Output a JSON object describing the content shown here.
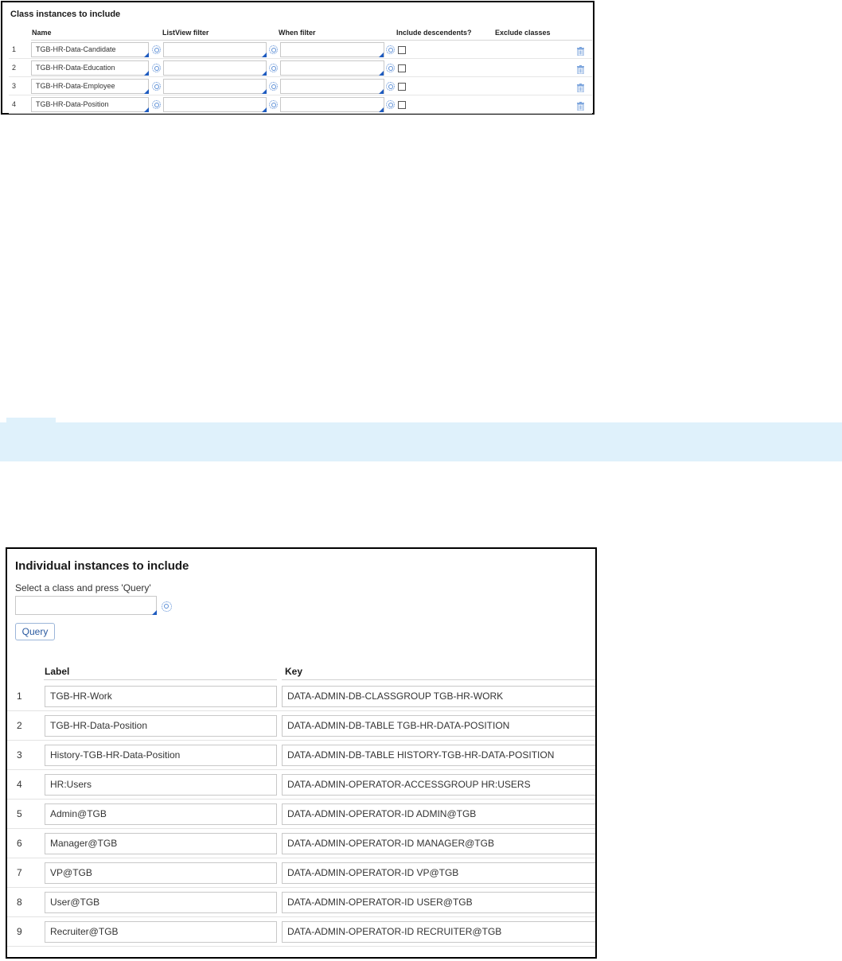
{
  "classes_panel": {
    "title": "Class instances to include",
    "columns": {
      "name": "Name",
      "listview": "ListView filter",
      "when": "When filter",
      "descendents": "Include descendents?",
      "exclude": "Exclude classes"
    },
    "rows": [
      {
        "num": "1",
        "name": "TGB-HR-Data-Candidate",
        "listview": "",
        "when": ""
      },
      {
        "num": "2",
        "name": "TGB-HR-Data-Education",
        "listview": "",
        "when": ""
      },
      {
        "num": "3",
        "name": "TGB-HR-Data-Employee",
        "listview": "",
        "when": ""
      },
      {
        "num": "4",
        "name": "TGB-HR-Data-Position",
        "listview": "",
        "when": ""
      }
    ]
  },
  "individual_panel": {
    "title": "Individual instances to include",
    "hint": "Select a class and press 'Query'",
    "class_select_value": "",
    "query_label": "Query",
    "columns": {
      "label": "Label",
      "key": "Key"
    },
    "rows": [
      {
        "num": "1",
        "label": "TGB-HR-Work",
        "key": "DATA-ADMIN-DB-CLASSGROUP TGB-HR-WORK"
      },
      {
        "num": "2",
        "label": "TGB-HR-Data-Position",
        "key": "DATA-ADMIN-DB-TABLE TGB-HR-DATA-POSITION"
      },
      {
        "num": "3",
        "label": "History-TGB-HR-Data-Position",
        "key": "DATA-ADMIN-DB-TABLE HISTORY-TGB-HR-DATA-POSITION"
      },
      {
        "num": "4",
        "label": "HR:Users",
        "key": "DATA-ADMIN-OPERATOR-ACCESSGROUP HR:USERS"
      },
      {
        "num": "5",
        "label": "Admin@TGB",
        "key": "DATA-ADMIN-OPERATOR-ID ADMIN@TGB"
      },
      {
        "num": "6",
        "label": "Manager@TGB",
        "key": "DATA-ADMIN-OPERATOR-ID MANAGER@TGB"
      },
      {
        "num": "7",
        "label": "VP@TGB",
        "key": "DATA-ADMIN-OPERATOR-ID VP@TGB"
      },
      {
        "num": "8",
        "label": "User@TGB",
        "key": "DATA-ADMIN-OPERATOR-ID USER@TGB"
      },
      {
        "num": "9",
        "label": "Recruiter@TGB",
        "key": "DATA-ADMIN-OPERATOR-ID RECRUITER@TGB"
      }
    ]
  },
  "colors": {
    "banner": "#dff1fb",
    "accent": "#1e5bbf",
    "icon": "#5d8fd6"
  },
  "icons": [
    "dropdown-triangle-icon",
    "gear-icon",
    "trash-icon",
    "checkbox"
  ]
}
